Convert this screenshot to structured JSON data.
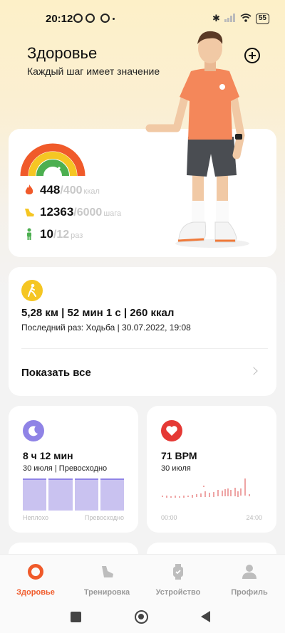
{
  "status_bar": {
    "time": "20:12",
    "battery": "55"
  },
  "header": {
    "title": "Здоровье",
    "subtitle": "Каждый шаг имеет значение",
    "add_icon": "plus-circle-icon"
  },
  "activity": {
    "calories": {
      "value": "448",
      "goal": "/400",
      "unit": "ккал",
      "icon": "flame-icon",
      "color": "#f05a2a",
      "progress": 1.0
    },
    "steps": {
      "value": "12363",
      "goal": "/6000",
      "unit": "шага",
      "icon": "shoe-icon",
      "color": "#f5c623",
      "progress": 1.0
    },
    "standing": {
      "value": "10",
      "goal": "/12",
      "unit": "раз",
      "icon": "person-icon",
      "color": "#4caf50",
      "progress": 0.83
    }
  },
  "workout": {
    "icon": "walking-icon",
    "summary": "5,28 км | 52 мин 1 с | 260 ккал",
    "last": "Последний раз: Ходьба | 30.07.2022, 19:08",
    "show_all": "Показать все"
  },
  "sleep": {
    "icon": "moon-icon",
    "title": "8 ч 12 мин",
    "sub": "30 июля | Превосходно",
    "axis_left": "Неплохо",
    "axis_right": "Превосходно",
    "color": "#8f83e6"
  },
  "heart": {
    "icon": "heart-icon",
    "title": "71 BPM",
    "sub": "30 июля",
    "axis_left": "00:00",
    "axis_right": "24:00",
    "color": "#e53935"
  },
  "nav": {
    "items": [
      {
        "label": "Здоровье",
        "icon": "health-ring-icon",
        "active": true
      },
      {
        "label": "Тренировка",
        "icon": "shoe-icon",
        "active": false
      },
      {
        "label": "Устройство",
        "icon": "watch-icon",
        "active": false
      },
      {
        "label": "Профиль",
        "icon": "profile-icon",
        "active": false
      }
    ]
  },
  "colors": {
    "accent": "#f05a2a",
    "header_bg": "#fdf0c8"
  }
}
